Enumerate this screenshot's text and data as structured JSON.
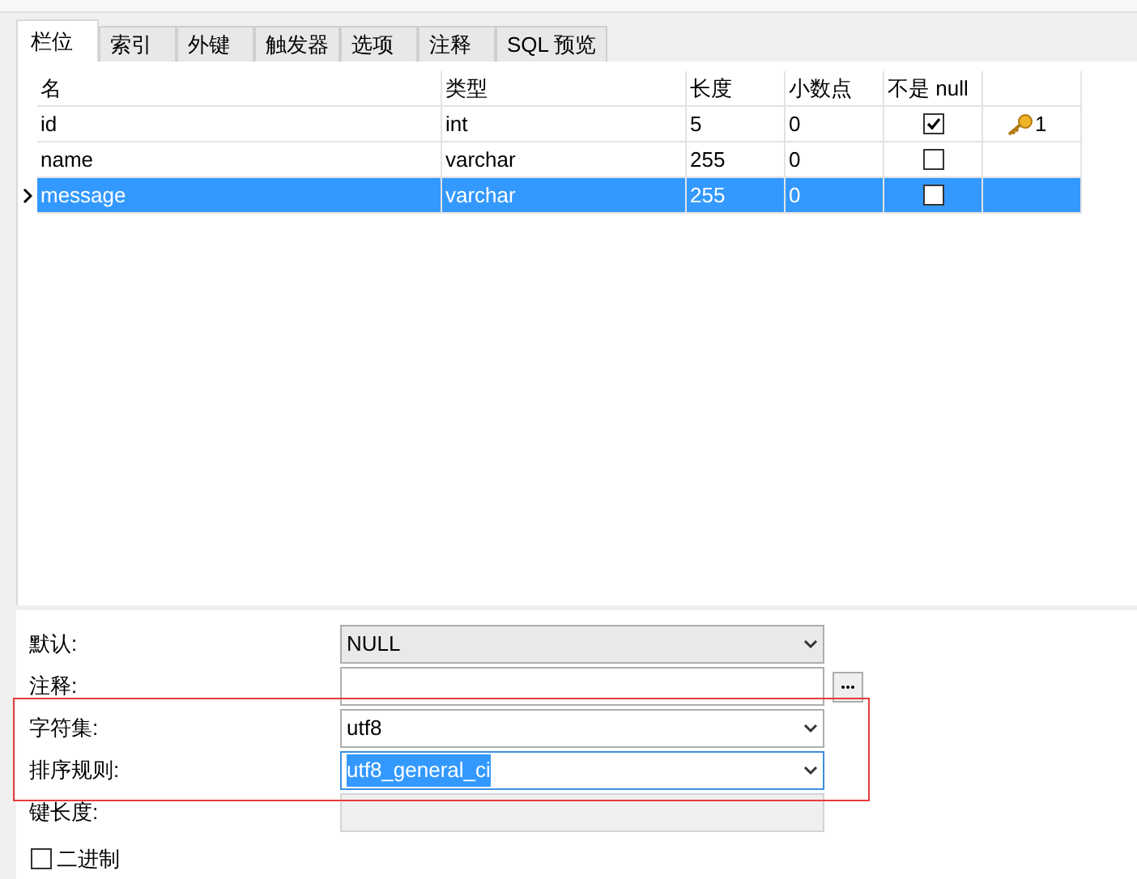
{
  "tabs": [
    {
      "label": "栏位",
      "selected": true
    },
    {
      "label": "索引",
      "selected": false
    },
    {
      "label": "外键",
      "selected": false
    },
    {
      "label": "触发器",
      "selected": false
    },
    {
      "label": "选项",
      "selected": false
    },
    {
      "label": "注释",
      "selected": false
    },
    {
      "label": "SQL 预览",
      "selected": false
    }
  ],
  "table": {
    "columns": [
      "名",
      "类型",
      "长度",
      "小数点",
      "不是 null"
    ],
    "rows": [
      {
        "name": "id",
        "type": "int",
        "length": "5",
        "decimals": "0",
        "not_null": true,
        "primary_key": true,
        "key_order": "1",
        "selected": false
      },
      {
        "name": "name",
        "type": "varchar",
        "length": "255",
        "decimals": "0",
        "not_null": false,
        "primary_key": false,
        "selected": false
      },
      {
        "name": "message",
        "type": "varchar",
        "length": "255",
        "decimals": "0",
        "not_null": false,
        "primary_key": false,
        "selected": true
      }
    ]
  },
  "properties": [
    {
      "kind": "dropdown",
      "label": "默认:",
      "value": "NULL",
      "text_selected": false
    },
    {
      "kind": "text",
      "label": "注释:"
    },
    {
      "kind": "combo",
      "label": "字符集:",
      "value": "utf8",
      "text_selected": false
    },
    {
      "kind": "combo",
      "label": "排序规则:",
      "value": "utf8_general_ci",
      "text_selected": true
    },
    {
      "kind": "readonly",
      "label": "键长度:"
    }
  ],
  "binary": {
    "label": "二进制",
    "checked": false
  }
}
